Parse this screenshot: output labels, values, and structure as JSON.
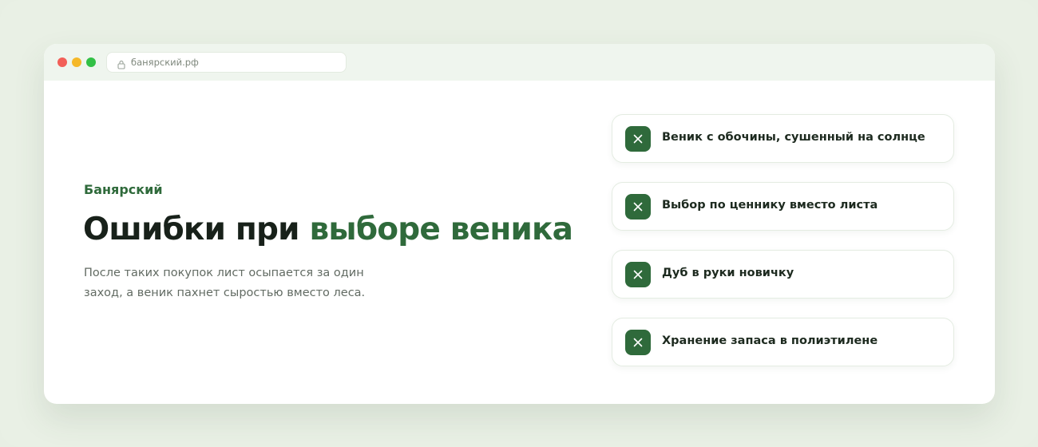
{
  "browser": {
    "url": "банярский.рф"
  },
  "hero": {
    "brand": "Банярский",
    "title_main": "Ошибки при ",
    "title_accent": "выборе веника",
    "lead": "После таких покупок лист осыпается за один заход, а веник пахнет сыростью вместо леса."
  },
  "mistakes": [
    {
      "label": "Веник с обочины, сушенный на солнце",
      "icon": "close-icon"
    },
    {
      "label": "Выбор по ценнику вместо листа",
      "icon": "close-icon"
    },
    {
      "label": "Дуб в руки новичку",
      "icon": "close-icon"
    },
    {
      "label": "Хранение запаса в полиэтилене",
      "icon": "close-icon"
    }
  ],
  "colors": {
    "accent": "#2f6a3b",
    "background": "#e9f0e5",
    "titlebar": "#eff5ee"
  }
}
